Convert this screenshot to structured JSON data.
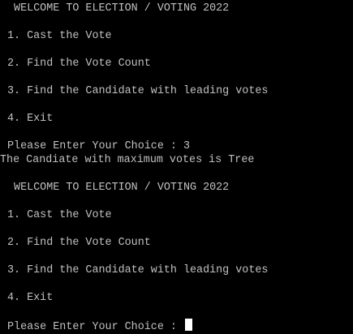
{
  "colors": {
    "background": "#000000",
    "text": "#c0c0c0",
    "cursor": "#ffffff"
  },
  "session": {
    "block1": {
      "title": " WELCOME TO ELECTION / VOTING 2022",
      "option1": "1. Cast the Vote",
      "option2": "2. Find the Vote Count",
      "option3": "3. Find the Candidate with leading votes",
      "option4": "4. Exit",
      "prompt": "Please Enter Your Choice : ",
      "input": "3",
      "result": "The Candiate with maximum votes is Tree"
    },
    "block2": {
      "title": " WELCOME TO ELECTION / VOTING 2022",
      "option1": "1. Cast the Vote",
      "option2": "2. Find the Vote Count",
      "option3": "3. Find the Candidate with leading votes",
      "option4": "4. Exit",
      "prompt": "Please Enter Your Choice : "
    }
  }
}
